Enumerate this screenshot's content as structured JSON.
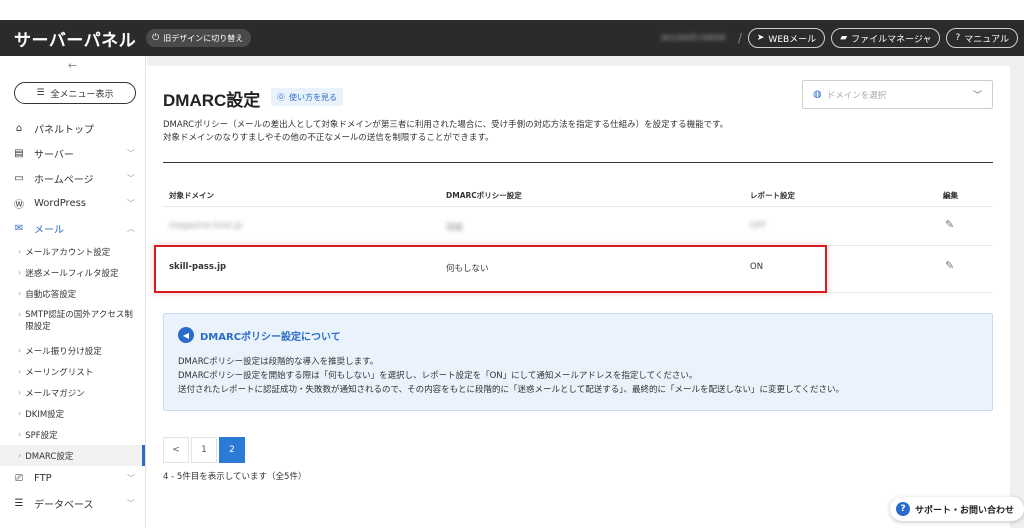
{
  "header": {
    "brand": "サーバーパネル",
    "switch_label": "旧デザインに切り替え",
    "account": "account-name",
    "buttons": [
      {
        "label": "WEBメール",
        "icon": "paper-plane-icon"
      },
      {
        "label": "ファイルマネージャ",
        "icon": "folder-icon"
      },
      {
        "label": "マニュアル",
        "icon": "help-circle-icon"
      }
    ]
  },
  "sidebar": {
    "all_menu": "全メニュー表示",
    "items": [
      {
        "label": "パネルトップ",
        "icon": "home-icon"
      },
      {
        "label": "サーバー",
        "icon": "server-icon"
      },
      {
        "label": "ホームページ",
        "icon": "window-icon"
      },
      {
        "label": "WordPress",
        "icon": "wordpress-icon"
      },
      {
        "label": "メール",
        "icon": "mail-icon"
      }
    ],
    "mail_sub": [
      "メールアカウント設定",
      "迷惑メールフィルタ設定",
      "自動応答設定",
      "SMTP認証の国外アクセス制限設定",
      "メール振り分け設定",
      "メーリングリスト",
      "メールマガジン",
      "DKIM設定",
      "SPF設定",
      "DMARC設定"
    ],
    "bottom_items": [
      {
        "label": "FTP",
        "icon": "ftp-icon"
      },
      {
        "label": "データベース",
        "icon": "database-icon"
      }
    ]
  },
  "page": {
    "title": "DMARC設定",
    "howto": "使い方を見る",
    "domain_placeholder": "ドメインを選択",
    "desc_line1": "DMARCポリシー（メールの差出人として対象ドメインが第三者に利用された場合に、受け手側の対応方法を指定する仕組み）を設定する機能です。",
    "desc_line2": "対象ドメインのなりすましやその他の不正なメールの送信を制限することができます。"
  },
  "table": {
    "headers": [
      "対象ドメイン",
      "DMARCポリシー設定",
      "レポート設定",
      "編集"
    ],
    "rows": [
      {
        "domain": "magazine-host.jp",
        "policy": "隔離",
        "report": "OFF"
      },
      {
        "domain": "skill-pass.jp",
        "policy": "何もしない",
        "report": "ON"
      }
    ]
  },
  "info": {
    "title": "DMARCポリシー設定について",
    "line1": "DMARCポリシー設定は段階的な導入を推奨します。",
    "line2": "DMARCポリシー設定を開始する際は「何もしない」を選択し、レポート設定を「ON」にして通知メールアドレスを指定してください。",
    "line3": "送付されたレポートに認証成功・失敗数が通知されるので、その内容をもとに段階的に「迷惑メールとして配送する」、最終的に「メールを配送しない」に変更してください。"
  },
  "pagination": {
    "prev": "<",
    "pages": [
      "1",
      "2"
    ],
    "current": "2",
    "count_text": "4 - 5件目を表示しています（全5件）"
  },
  "support": {
    "label": "サポート・お問い合わせ"
  },
  "colors": {
    "accent": "#2a6cc9",
    "highlight": "#d21e1e",
    "topbar": "#2b2b2b"
  }
}
